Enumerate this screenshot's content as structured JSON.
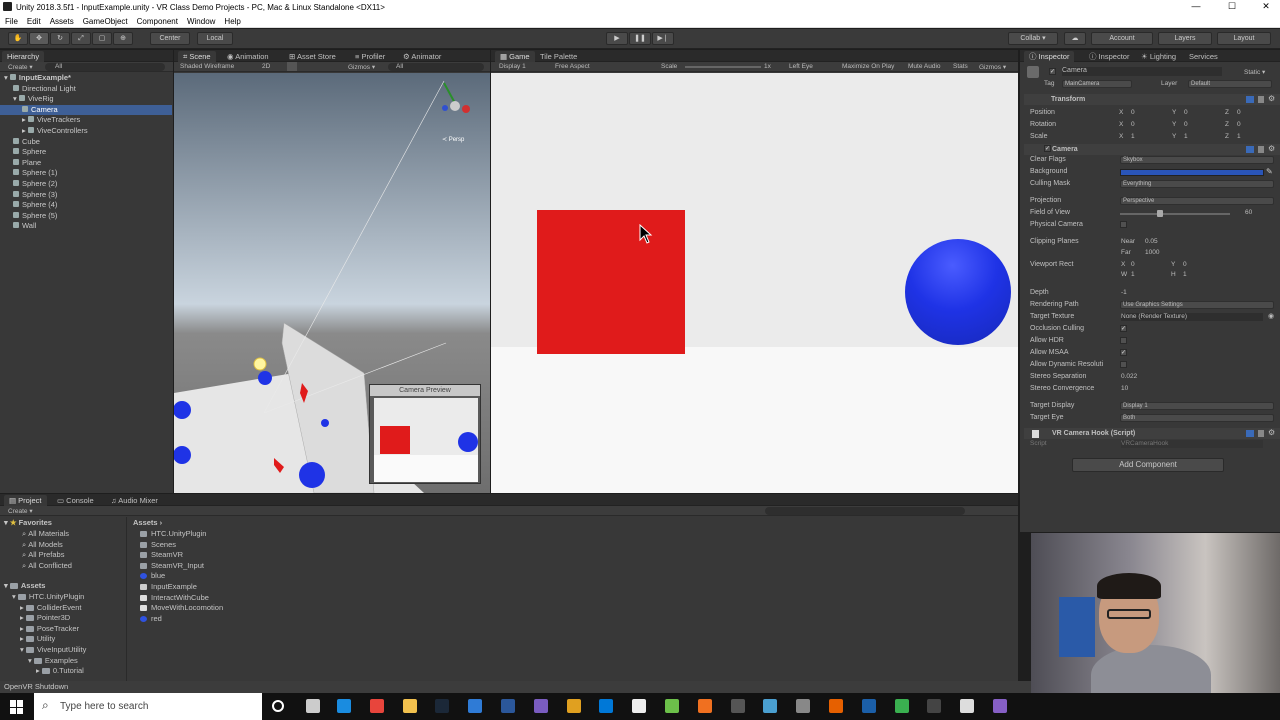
{
  "window": {
    "title": "Unity 2018.3.5f1 - InputExample.unity - VR Class Demo Projects - PC, Mac & Linux Standalone <DX11>",
    "minimize": "—",
    "maximize": "☐",
    "close": "✕"
  },
  "menu": [
    "File",
    "Edit",
    "Assets",
    "GameObject",
    "Component",
    "Window",
    "Help"
  ],
  "toolbar": {
    "pivot": "Center",
    "space": "Local",
    "collab": "Collab ▾",
    "account": "Account",
    "layers": "Layers",
    "layout": "Layout"
  },
  "hierarchy": {
    "tab": "Hierarchy",
    "create": "Create ▾",
    "search": "All",
    "items": [
      {
        "label": "InputExample*",
        "level": 0
      },
      {
        "label": "Directional Light",
        "level": 1
      },
      {
        "label": "ViveRig",
        "level": 1
      },
      {
        "label": "Camera",
        "level": 2
      },
      {
        "label": "ViveTrackers",
        "level": 2
      },
      {
        "label": "ViveControllers",
        "level": 2
      },
      {
        "label": "Cube",
        "level": 1
      },
      {
        "label": "Sphere",
        "level": 1
      },
      {
        "label": "Plane",
        "level": 1
      },
      {
        "label": "Sphere (1)",
        "level": 1
      },
      {
        "label": "Sphere (2)",
        "level": 1
      },
      {
        "label": "Sphere (3)",
        "level": 1
      },
      {
        "label": "Sphere (4)",
        "level": 1
      },
      {
        "label": "Sphere (5)",
        "level": 1
      },
      {
        "label": "Wall",
        "level": 1
      }
    ]
  },
  "scene": {
    "tabs": [
      "Scene",
      "Animation",
      "Asset Store",
      "Profiler",
      "Animator"
    ],
    "shading": "Shaded Wireframe",
    "mode2d": "2D",
    "gizmos": "Gizmos ▾",
    "search": "All",
    "persp": "≺ Persp",
    "camera_preview": "Camera Preview"
  },
  "game": {
    "tabs": [
      "Game",
      "Tile Palette"
    ],
    "display": "Display 1",
    "aspect": "Free Aspect",
    "scale_label": "Scale",
    "scale_value": "1x",
    "left_eye": "Left Eye",
    "options": [
      "Maximize On Play",
      "Mute Audio",
      "Stats",
      "Gizmos ▾"
    ]
  },
  "inspector": {
    "tabs": [
      "Inspector",
      "Inspector",
      "Lighting",
      "Services"
    ],
    "object_name": "Camera",
    "static": "Static ▾",
    "tag_label": "Tag",
    "tag": "MainCamera",
    "layer_label": "Layer",
    "layer": "Default",
    "transform": {
      "title": "Transform",
      "rows": [
        {
          "label": "Position",
          "x": "0",
          "y": "0",
          "z": "0"
        },
        {
          "label": "Rotation",
          "x": "0",
          "y": "0",
          "z": "0"
        },
        {
          "label": "Scale",
          "x": "1",
          "y": "1",
          "z": "1"
        }
      ]
    },
    "camera": {
      "title": "Camera",
      "clear_flags": {
        "label": "Clear Flags",
        "value": "Skybox"
      },
      "background": {
        "label": "Background"
      },
      "culling_mask": {
        "label": "Culling Mask",
        "value": "Everything"
      },
      "projection": {
        "label": "Projection",
        "value": "Perspective"
      },
      "fov": {
        "label": "Field of View",
        "value": "60"
      },
      "physical": {
        "label": "Physical Camera"
      },
      "clipping": {
        "label": "Clipping Planes",
        "near_label": "Near",
        "near": "0.05",
        "far_label": "Far",
        "far": "1000"
      },
      "viewport": {
        "label": "Viewport Rect",
        "x": "0",
        "y": "0",
        "w": "1",
        "h": "1"
      },
      "depth": {
        "label": "Depth",
        "value": "-1"
      },
      "rendering_path": {
        "label": "Rendering Path",
        "value": "Use Graphics Settings"
      },
      "target_texture": {
        "label": "Target Texture",
        "value": "None (Render Texture)"
      },
      "occlusion": {
        "label": "Occlusion Culling"
      },
      "hdr": {
        "label": "Allow HDR"
      },
      "msaa": {
        "label": "Allow MSAA"
      },
      "dynres": {
        "label": "Allow Dynamic Resoluti"
      },
      "stereo_sep": {
        "label": "Stereo Separation",
        "value": "0.022"
      },
      "stereo_conv": {
        "label": "Stereo Convergence",
        "value": "10"
      },
      "target_display": {
        "label": "Target Display",
        "value": "Display 1"
      },
      "target_eye": {
        "label": "Target Eye",
        "value": "Both"
      }
    },
    "script": {
      "title": "VR Camera Hook (Script)",
      "label": "Script",
      "value": "VRCameraHook"
    },
    "add_component": "Add Component"
  },
  "project": {
    "tabs": [
      "Project",
      "Console",
      "Audio Mixer"
    ],
    "create": "Create ▾",
    "favorites_title": "Favorites",
    "favorites": [
      "All Materials",
      "All Models",
      "All Prefabs",
      "All Conflicted"
    ],
    "assets_title": "Assets",
    "tree": [
      {
        "label": "HTC.UnityPlugin",
        "level": 1
      },
      {
        "label": "ColliderEvent",
        "level": 2
      },
      {
        "label": "Pointer3D",
        "level": 2
      },
      {
        "label": "PoseTracker",
        "level": 2
      },
      {
        "label": "Utility",
        "level": 2
      },
      {
        "label": "ViveInputUtility",
        "level": 2
      },
      {
        "label": "Examples",
        "level": 3
      },
      {
        "label": "0.Tutorial",
        "level": 4
      }
    ],
    "breadcrumb": "Assets ›",
    "items": [
      {
        "label": "HTC.UnityPlugin",
        "kind": "folder"
      },
      {
        "label": "Scenes",
        "kind": "folder"
      },
      {
        "label": "SteamVR",
        "kind": "folder"
      },
      {
        "label": "SteamVR_Input",
        "kind": "folder"
      },
      {
        "label": "blue",
        "kind": "material"
      },
      {
        "label": "InputExample",
        "kind": "scene"
      },
      {
        "label": "InteractWithCube",
        "kind": "script"
      },
      {
        "label": "MoveWithLocomotion",
        "kind": "script"
      },
      {
        "label": "red",
        "kind": "material"
      }
    ]
  },
  "status": "OpenVR Shutdown",
  "taskbar": {
    "search_placeholder": "Type here to search",
    "icons": [
      "cortana-icon",
      "task-view-icon",
      "edge-icon",
      "chrome-icon",
      "explorer-icon",
      "steam-icon",
      "vscode-blue-icon",
      "word-icon",
      "unity-hub-icon",
      "lock-icon",
      "store-icon",
      "github-icon",
      "android-icon",
      "flame-icon",
      "calculator-icon",
      "network-icon",
      "vr-icon",
      "firefox-icon",
      "steamvr-icon",
      "green-icon",
      "terminal-icon",
      "unity-icon",
      "visual-studio-icon"
    ]
  },
  "colors": {
    "cube": "#e01b1b",
    "sphere": "#1f33e6",
    "selection": "#3e5f96",
    "background_swatch": "#2a55b8"
  }
}
